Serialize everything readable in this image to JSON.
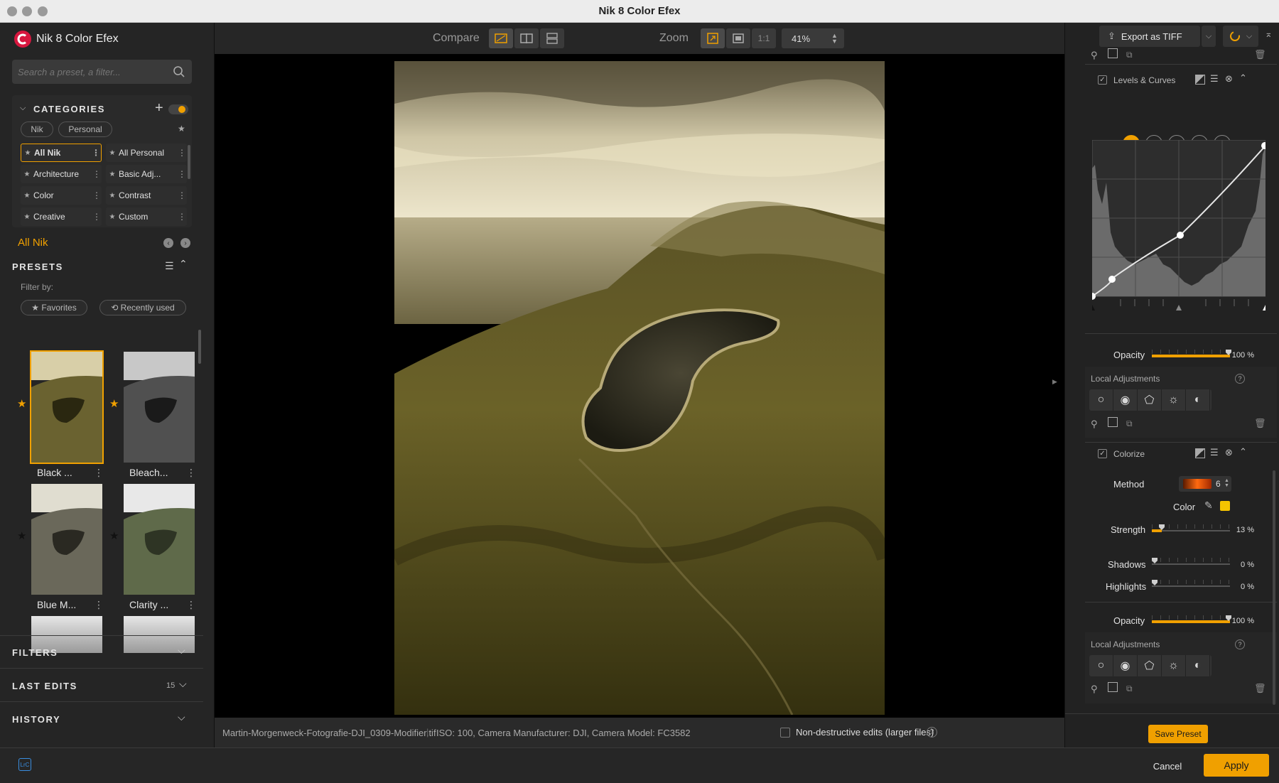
{
  "window": {
    "title": "Nik 8 Color Efex"
  },
  "app": {
    "name": "Nik 8 Color Efex"
  },
  "search": {
    "placeholder": "Search a preset, a filter..."
  },
  "categories": {
    "heading": "CATEGORIES",
    "tabs": [
      "Nik",
      "Personal"
    ],
    "items": [
      {
        "label": "All Nik",
        "selected": true
      },
      {
        "label": "All Personal"
      },
      {
        "label": "Architecture"
      },
      {
        "label": "Basic Adj..."
      },
      {
        "label": "Color"
      },
      {
        "label": "Contrast"
      },
      {
        "label": "Creative"
      },
      {
        "label": "Custom"
      }
    ]
  },
  "current_category": "All Nik",
  "presets": {
    "heading": "PRESETS",
    "filter_by": "Filter by:",
    "filters": [
      "★ Favorites",
      "⟲ Recently used"
    ],
    "thumbs": [
      {
        "label": "Black ...",
        "favorite": true
      },
      {
        "label": "Bleach...",
        "favorite": true
      },
      {
        "label": "Blue M...",
        "favorite": false
      },
      {
        "label": "Clarity ...",
        "favorite": false
      }
    ]
  },
  "sections": {
    "filters": "FILTERS",
    "last_edits": "LAST EDITS",
    "last_edits_count": "15",
    "history": "HISTORY"
  },
  "toolbar": {
    "compare": "Compare",
    "zoom": "Zoom",
    "one_to_one": "1:1",
    "zoom_level": "41%"
  },
  "info": {
    "filename": "Martin-Morgenweck-Fotografie-DJI_0309-Modifier.tif",
    "exif": "ISO: 100, Camera Manufacturer: DJI, Camera Model: FC3582",
    "nondestructive": "Non-destructive edits (larger files)"
  },
  "export": {
    "label": "Export as TIFF"
  },
  "levels": {
    "title": "Levels & Curves",
    "channels": [
      "RGB",
      "R",
      "G",
      "B",
      "L"
    ],
    "opacity_label": "Opacity",
    "opacity_value": "100 %",
    "opacity_level": 1.0
  },
  "local_adjustments": "Local Adjustments",
  "colorize": {
    "title": "Colorize",
    "method_label": "Method",
    "method_value": "6",
    "color_label": "Color",
    "color_swatch": "#f5c400",
    "strength_label": "Strength",
    "strength_value": "13 %",
    "strength_level": 0.13,
    "shadows_label": "Shadows",
    "shadows_value": "0 %",
    "highlights_label": "Highlights",
    "highlights_value": "0 %",
    "opacity_label": "Opacity",
    "opacity_value": "100 %"
  },
  "save_preset": "Save Preset",
  "bottom": {
    "lrc": "LrC",
    "cancel": "Cancel",
    "apply": "Apply"
  },
  "colors": {
    "accent": "#f0a000",
    "brand": "#d8173f"
  }
}
